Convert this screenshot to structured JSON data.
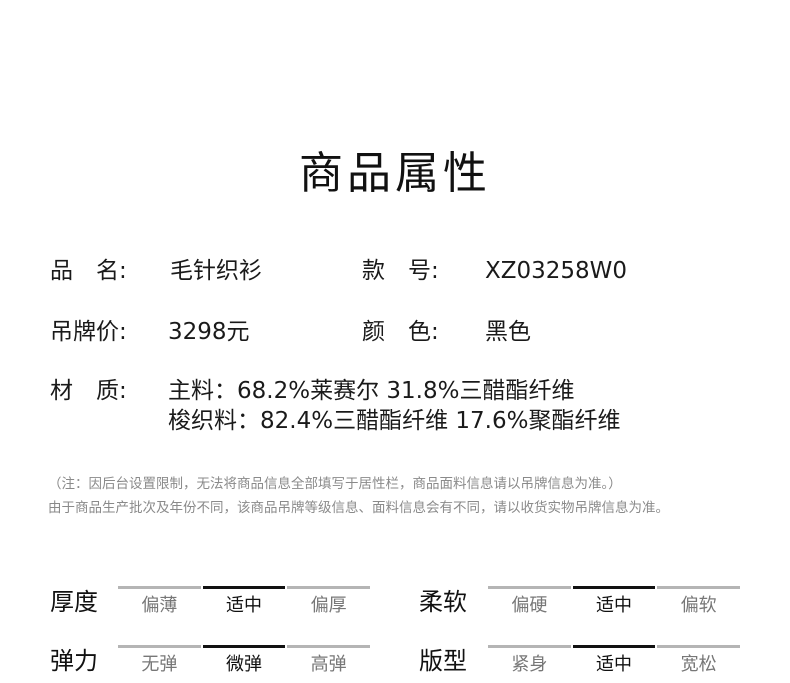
{
  "title": "商品属性",
  "attributes": {
    "name_label": "品　名:",
    "name_value": "毛针织衫",
    "style_label": "款　号:",
    "style_value": "XZ03258W0",
    "price_label": "吊牌价:",
    "price_value": "3298元",
    "color_label": "颜　色:",
    "color_value": "黑色",
    "material_label": "材　质:",
    "material_line1": "主料：68.2%莱赛尔 31.8%三醋酯纤维",
    "material_line2": "梭织料：82.4%三醋酯纤维 17.6%聚酯纤维"
  },
  "notes": {
    "line1": "（注：因后台设置限制，无法将商品信息全部填写于居性栏，商品面料信息请以吊牌信息为准。）",
    "line2": "由于商品生产批次及年份不同，该商品吊牌等级信息、面料信息会有不同，请以收货实物吊牌信息为准。"
  },
  "scales": [
    {
      "name": "厚度",
      "options": [
        "偏薄",
        "适中",
        "偏厚"
      ],
      "selected": 1
    },
    {
      "name": "柔软",
      "options": [
        "偏硬",
        "适中",
        "偏软"
      ],
      "selected": 1
    },
    {
      "name": "弹力",
      "options": [
        "无弹",
        "微弹",
        "高弹"
      ],
      "selected": 1
    },
    {
      "name": "版型",
      "options": [
        "紧身",
        "适中",
        "宽松"
      ],
      "selected": 1
    }
  ]
}
